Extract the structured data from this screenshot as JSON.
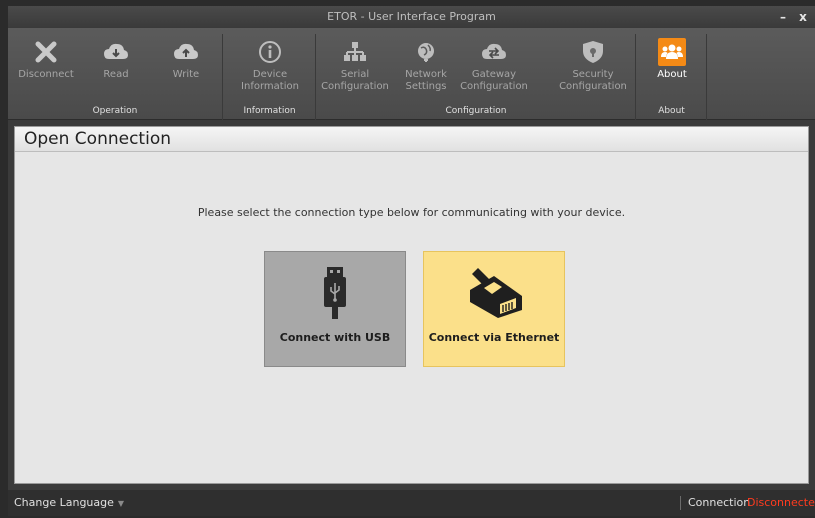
{
  "window": {
    "title": "ETOR - User Interface Program",
    "minimize": "–",
    "close": "x"
  },
  "ribbon": {
    "operation": {
      "label": "Operation",
      "buttons": [
        {
          "label": "Disconnect"
        },
        {
          "label": "Read"
        },
        {
          "label": "Write"
        }
      ]
    },
    "information": {
      "label": "Information",
      "buttons": [
        {
          "label": "Device Information"
        }
      ]
    },
    "configuration": {
      "label": "Configuration",
      "buttons": [
        {
          "label": "Serial Configuration"
        },
        {
          "label": "Network Settings"
        },
        {
          "label": "Gateway Configuration"
        },
        {
          "label": "Security Configuration"
        }
      ]
    },
    "about": {
      "label": "About",
      "buttons": [
        {
          "label": "About"
        }
      ]
    }
  },
  "panel": {
    "title": "Open Connection",
    "prompt": "Please select the connection type below for communicating with your device.",
    "tiles": [
      {
        "label": "Connect with USB",
        "icon": "usb-icon"
      },
      {
        "label": "Connect via Ethernet",
        "icon": "ethernet-icon"
      }
    ]
  },
  "statusbar": {
    "language": "Change Language",
    "connection_label": "Connection",
    "connection_state": "Disconnected"
  },
  "colors": {
    "about_icon": "#f48a16",
    "ethernet_tile": "#fbe08a",
    "usb_tile": "#a8a8a8",
    "disconnected": "#ff3b1f"
  }
}
